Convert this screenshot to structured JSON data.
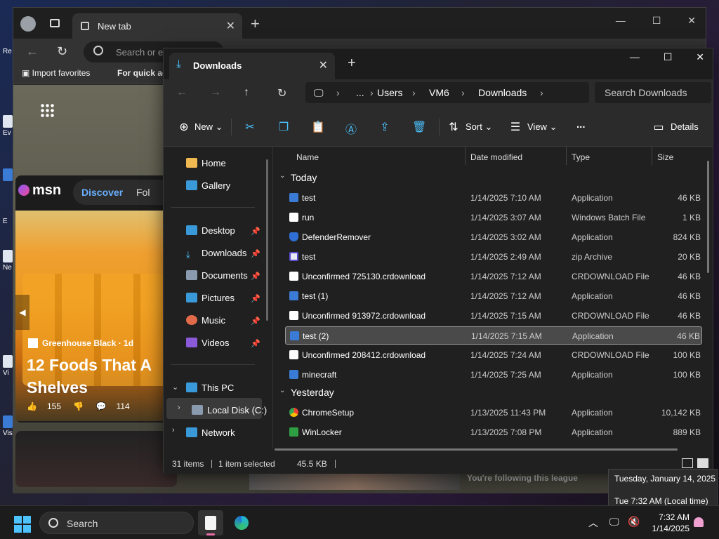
{
  "desktop": {
    "icons": [
      "Re",
      "Ev",
      "E",
      "Ne",
      "Vi",
      "Vis"
    ]
  },
  "browser": {
    "tab_title": "New tab",
    "address_placeholder": "Search or e",
    "favorites": [
      "Import favorites",
      "For quick ac"
    ],
    "msn": {
      "logo": "msn",
      "tabs": [
        "Discover",
        "Fol"
      ],
      "source": "Greenhouse Black · 1d",
      "headline": "12 Foods That A Shelves",
      "likes": "155",
      "comments": "114"
    },
    "following_text": "You're following this league"
  },
  "explorer": {
    "tab_title": "Downloads",
    "breadcrumb": [
      "...",
      "Users",
      "VM6",
      "Downloads"
    ],
    "search_placeholder": "Search Downloads",
    "commands": {
      "new": "New",
      "sort": "Sort",
      "view": "View",
      "more": "...",
      "details": "Details"
    },
    "nav": {
      "home": "Home",
      "gallery": "Gallery",
      "desktop": "Desktop",
      "downloads": "Downloads",
      "documents": "Documents",
      "pictures": "Pictures",
      "music": "Music",
      "videos": "Videos",
      "this_pc": "This PC",
      "local_disk": "Local Disk (C:)",
      "network": "Network"
    },
    "columns": [
      "Name",
      "Date modified",
      "Type",
      "Size"
    ],
    "groups": {
      "today": "Today",
      "yesterday": "Yesterday"
    },
    "files": [
      {
        "name": "test",
        "date": "1/14/2025 7:10 AM",
        "type": "Application",
        "size": "46 KB"
      },
      {
        "name": "run",
        "date": "1/14/2025 3:07 AM",
        "type": "Windows Batch File",
        "size": "1 KB"
      },
      {
        "name": "DefenderRemover",
        "date": "1/14/2025 3:02 AM",
        "type": "Application",
        "size": "824 KB"
      },
      {
        "name": "test",
        "date": "1/14/2025 2:49 AM",
        "type": "zip Archive",
        "size": "20 KB"
      },
      {
        "name": "Unconfirmed 725130.crdownload",
        "date": "1/14/2025 7:12 AM",
        "type": "CRDOWNLOAD File",
        "size": "46 KB"
      },
      {
        "name": "test (1)",
        "date": "1/14/2025 7:12 AM",
        "type": "Application",
        "size": "46 KB"
      },
      {
        "name": "Unconfirmed 913972.crdownload",
        "date": "1/14/2025 7:15 AM",
        "type": "CRDOWNLOAD File",
        "size": "46 KB"
      },
      {
        "name": "test (2)",
        "date": "1/14/2025 7:15 AM",
        "type": "Application",
        "size": "46 KB"
      },
      {
        "name": "Unconfirmed 208412.crdownload",
        "date": "1/14/2025 7:24 AM",
        "type": "CRDOWNLOAD File",
        "size": "100 KB"
      },
      {
        "name": "minecraft",
        "date": "1/14/2025 7:25 AM",
        "type": "Application",
        "size": "100 KB"
      },
      {
        "name": "ChromeSetup",
        "date": "1/13/2025 11:43 PM",
        "type": "Application",
        "size": "10,142 KB"
      },
      {
        "name": "WinLocker",
        "date": "1/13/2025 7:08 PM",
        "type": "Application",
        "size": "889 KB"
      }
    ],
    "status": {
      "items": "31 items",
      "selected": "1 item selected",
      "size": "45.5 KB"
    }
  },
  "tooltip": {
    "date": "Tuesday, January 14, 2025",
    "time": "Tue 7:32 AM (Local time)"
  },
  "taskbar": {
    "search": "Search",
    "clock_time": "7:32 AM",
    "clock_date": "1/14/2025"
  },
  "colors": {
    "accent": "#4cc2ff",
    "explorer_bg": "#202020",
    "selection": "#4a4a4a"
  }
}
